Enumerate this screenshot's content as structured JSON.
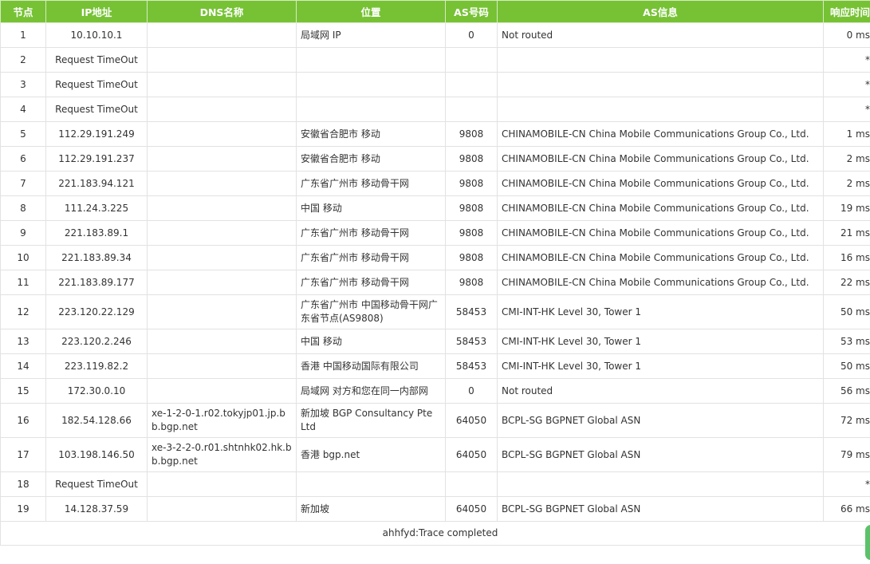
{
  "headers": [
    "节点",
    "IP地址",
    "DNS名称",
    "位置",
    "AS号码",
    "AS信息",
    "响应时间"
  ],
  "rows": [
    {
      "hop": "1",
      "ip": "10.10.10.1",
      "dns": "",
      "loc": "局域网 IP",
      "as": "0",
      "asinfo": "Not routed",
      "time": "0 ms"
    },
    {
      "hop": "2",
      "ip": "Request TimeOut",
      "dns": "",
      "loc": "",
      "as": "",
      "asinfo": "",
      "time": "*"
    },
    {
      "hop": "3",
      "ip": "Request TimeOut",
      "dns": "",
      "loc": "",
      "as": "",
      "asinfo": "",
      "time": "*"
    },
    {
      "hop": "4",
      "ip": "Request TimeOut",
      "dns": "",
      "loc": "",
      "as": "",
      "asinfo": "",
      "time": "*"
    },
    {
      "hop": "5",
      "ip": "112.29.191.249",
      "dns": "",
      "loc": "安徽省合肥市 移动",
      "as": "9808",
      "asinfo": "CHINAMOBILE-CN China Mobile Communications Group Co., Ltd.",
      "time": "1 ms"
    },
    {
      "hop": "6",
      "ip": "112.29.191.237",
      "dns": "",
      "loc": "安徽省合肥市 移动",
      "as": "9808",
      "asinfo": "CHINAMOBILE-CN China Mobile Communications Group Co., Ltd.",
      "time": "2 ms"
    },
    {
      "hop": "7",
      "ip": "221.183.94.121",
      "dns": "",
      "loc": "广东省广州市 移动骨干网",
      "as": "9808",
      "asinfo": "CHINAMOBILE-CN China Mobile Communications Group Co., Ltd.",
      "time": "2 ms"
    },
    {
      "hop": "8",
      "ip": "111.24.3.225",
      "dns": "",
      "loc": "中国 移动",
      "as": "9808",
      "asinfo": "CHINAMOBILE-CN China Mobile Communications Group Co., Ltd.",
      "time": "19 ms"
    },
    {
      "hop": "9",
      "ip": "221.183.89.1",
      "dns": "",
      "loc": "广东省广州市 移动骨干网",
      "as": "9808",
      "asinfo": "CHINAMOBILE-CN China Mobile Communications Group Co., Ltd.",
      "time": "21 ms"
    },
    {
      "hop": "10",
      "ip": "221.183.89.34",
      "dns": "",
      "loc": "广东省广州市 移动骨干网",
      "as": "9808",
      "asinfo": "CHINAMOBILE-CN China Mobile Communications Group Co., Ltd.",
      "time": "16 ms"
    },
    {
      "hop": "11",
      "ip": "221.183.89.177",
      "dns": "",
      "loc": "广东省广州市 移动骨干网",
      "as": "9808",
      "asinfo": "CHINAMOBILE-CN China Mobile Communications Group Co., Ltd.",
      "time": "22 ms"
    },
    {
      "hop": "12",
      "ip": "223.120.22.129",
      "dns": "",
      "loc": "广东省广州市 中国移动骨干网广东省节点(AS9808)",
      "as": "58453",
      "asinfo": "CMI-INT-HK Level 30, Tower 1",
      "time": "50 ms"
    },
    {
      "hop": "13",
      "ip": "223.120.2.246",
      "dns": "",
      "loc": "中国 移动",
      "as": "58453",
      "asinfo": "CMI-INT-HK Level 30, Tower 1",
      "time": "53 ms"
    },
    {
      "hop": "14",
      "ip": "223.119.82.2",
      "dns": "",
      "loc": "香港 中国移动国际有限公司",
      "as": "58453",
      "asinfo": "CMI-INT-HK Level 30, Tower 1",
      "time": "50 ms"
    },
    {
      "hop": "15",
      "ip": "172.30.0.10",
      "dns": "",
      "loc": "局域网 对方和您在同一内部网",
      "as": "0",
      "asinfo": "Not routed",
      "time": "56 ms"
    },
    {
      "hop": "16",
      "ip": "182.54.128.66",
      "dns": "xe-1-2-0-1.r02.tokyjp01.jp.bb.bgp.net",
      "loc": "新加坡 BGP Consultancy Pte Ltd",
      "as": "64050",
      "asinfo": "BCPL-SG BGPNET Global ASN",
      "time": "72 ms"
    },
    {
      "hop": "17",
      "ip": "103.198.146.50",
      "dns": "xe-3-2-2-0.r01.shtnhk02.hk.bb.bgp.net",
      "loc": "香港 bgp.net",
      "as": "64050",
      "asinfo": "BCPL-SG BGPNET Global ASN",
      "time": "79 ms"
    },
    {
      "hop": "18",
      "ip": "Request TimeOut",
      "dns": "",
      "loc": "",
      "as": "",
      "asinfo": "",
      "time": "*"
    },
    {
      "hop": "19",
      "ip": "14.128.37.59",
      "dns": "",
      "loc": "新加坡",
      "as": "64050",
      "asinfo": "BCPL-SG BGPNET Global ASN",
      "time": "66 ms"
    }
  ],
  "footer": "ahhfyd:Trace completed"
}
